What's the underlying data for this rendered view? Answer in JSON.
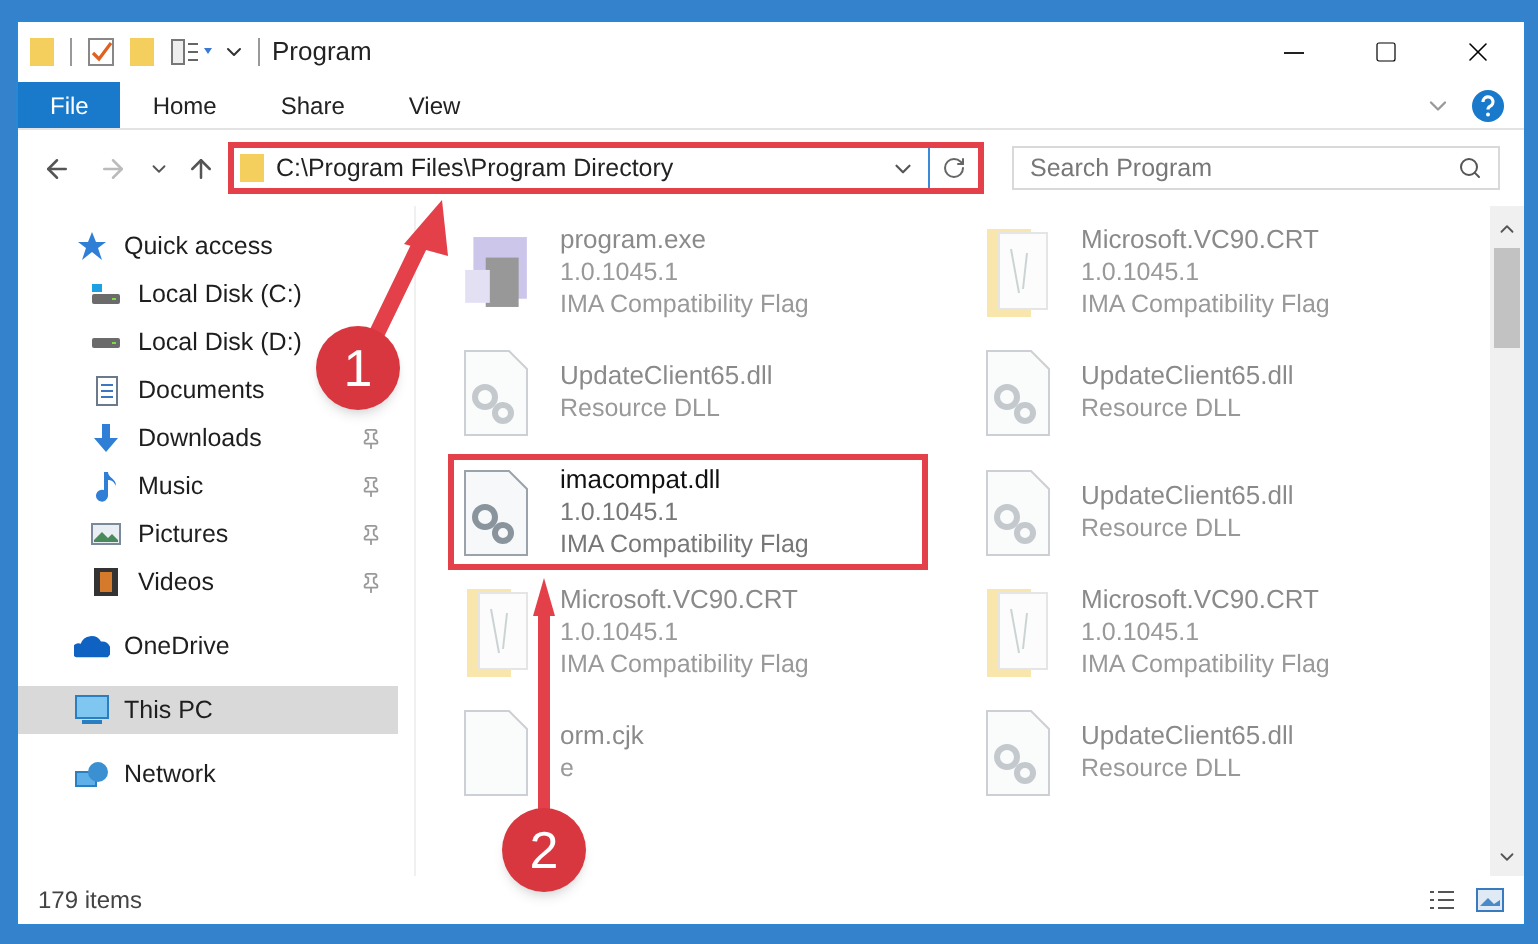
{
  "window": {
    "title": "Program"
  },
  "ribbon_tabs": [
    {
      "label": "File",
      "selected": true
    },
    {
      "label": "Home",
      "selected": false
    },
    {
      "label": "Share",
      "selected": false
    },
    {
      "label": "View",
      "selected": false
    }
  ],
  "address": {
    "path": "C:\\Program Files\\Program Directory",
    "highlighted": true
  },
  "search": {
    "placeholder": "Search Program"
  },
  "sidebar": {
    "items": [
      {
        "label": "Quick access",
        "kind": "star",
        "selected": false,
        "children": [
          {
            "label": "Local Disk (C:)",
            "kind": "disk-c",
            "pinned": false,
            "selected": false
          },
          {
            "label": "Local Disk (D:)",
            "kind": "disk",
            "pinned": false,
            "selected": false
          },
          {
            "label": "Documents",
            "kind": "documents",
            "pinned": false,
            "selected": false
          },
          {
            "label": "Downloads",
            "kind": "downloads",
            "pinned": true,
            "selected": false
          },
          {
            "label": "Music",
            "kind": "music",
            "pinned": true,
            "selected": false
          },
          {
            "label": "Pictures",
            "kind": "pictures",
            "pinned": true,
            "selected": false
          },
          {
            "label": "Videos",
            "kind": "videos",
            "pinned": true,
            "selected": false
          }
        ]
      },
      {
        "label": "OneDrive",
        "kind": "cloud",
        "selected": false
      },
      {
        "label": "This PC",
        "kind": "pc",
        "selected": true
      },
      {
        "label": "Network",
        "kind": "network",
        "selected": false
      }
    ]
  },
  "files": [
    {
      "name": "program.exe",
      "lines": [
        "1.0.1045.1",
        "IMA Compatibility Flag"
      ],
      "kind": "exe",
      "blurred": true,
      "highlighted": false
    },
    {
      "name": "Microsoft.VC90.CRT",
      "lines": [
        "1.0.1045.1",
        "IMA Compatibility Flag"
      ],
      "kind": "folder",
      "blurred": true,
      "highlighted": false
    },
    {
      "name": "UpdateClient65.dll",
      "lines": [
        "Resource DLL"
      ],
      "kind": "dll",
      "blurred": true,
      "highlighted": false
    },
    {
      "name": "UpdateClient65.dll",
      "lines": [
        "Resource DLL"
      ],
      "kind": "dll",
      "blurred": true,
      "highlighted": false
    },
    {
      "name": "imacompat.dll",
      "lines": [
        "1.0.1045.1",
        "IMA Compatibility Flag"
      ],
      "kind": "dll",
      "blurred": false,
      "highlighted": true
    },
    {
      "name": "UpdateClient65.dll",
      "lines": [
        "Resource DLL"
      ],
      "kind": "dll",
      "blurred": true,
      "highlighted": false
    },
    {
      "name": "Microsoft.VC90.CRT",
      "lines": [
        "1.0.1045.1",
        "IMA Compatibility Flag"
      ],
      "kind": "folder",
      "blurred": true,
      "highlighted": false
    },
    {
      "name": "Microsoft.VC90.CRT",
      "lines": [
        "1.0.1045.1",
        "IMA Compatibility Flag"
      ],
      "kind": "folder",
      "blurred": true,
      "highlighted": false
    },
    {
      "name": "orm.cjk",
      "lines": [
        "e"
      ],
      "kind": "file",
      "blurred": true,
      "highlighted": false
    },
    {
      "name": "UpdateClient65.dll",
      "lines": [
        "Resource DLL"
      ],
      "kind": "dll",
      "blurred": true,
      "highlighted": false
    }
  ],
  "status_bar": {
    "count": "179 items"
  },
  "annotations": [
    {
      "label": "1"
    },
    {
      "label": "2"
    }
  ]
}
